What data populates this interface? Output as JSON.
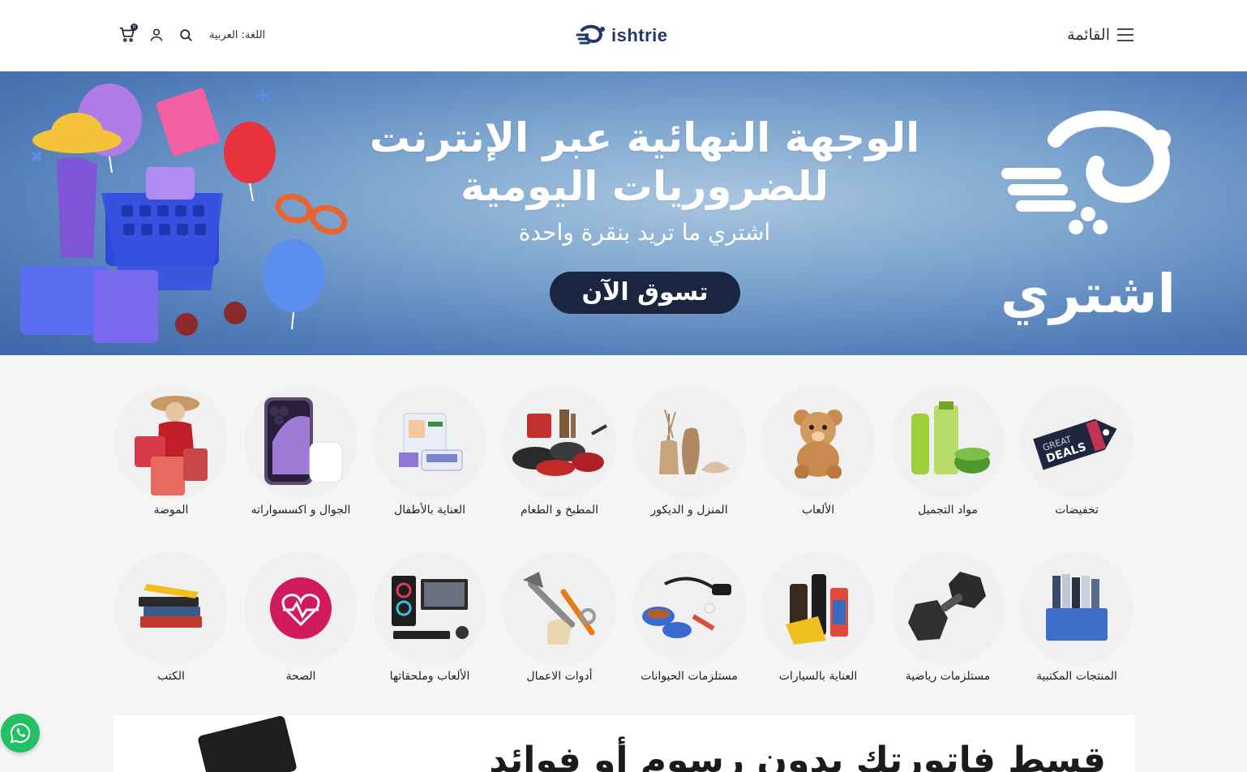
{
  "header": {
    "language_label": "اللغة: العربية",
    "cart_count": "0",
    "logo_text": "ishtrie",
    "menu_label": "القائمة"
  },
  "hero": {
    "title_line1": "الوجهة النهائية عبر الإنترنت",
    "title_line2": "للضروريات اليومية",
    "subtitle": "اشتري ما تريد بنقرة واحدة",
    "cta_label": "تسوق الآن",
    "brand_text": "اشتري"
  },
  "categories_row1": [
    {
      "label": "تخفيضات",
      "icon": "deals-tag-icon"
    },
    {
      "label": "مواد التجميل",
      "icon": "cosmetics-icon"
    },
    {
      "label": "الألعاب",
      "icon": "teddy-bear-icon"
    },
    {
      "label": "المنزل و الديكور",
      "icon": "vase-icon"
    },
    {
      "label": "المطبخ و الطعام",
      "icon": "cookware-icon"
    },
    {
      "label": "العناية بالأطفال",
      "icon": "baby-care-icon"
    },
    {
      "label": "الجوال و اكسسواراته",
      "icon": "phone-icon"
    },
    {
      "label": "الموضة",
      "icon": "fashion-icon"
    }
  ],
  "categories_row2": [
    {
      "label": "المنتجات المكتبية",
      "icon": "office-supplies-icon"
    },
    {
      "label": "مستلزمات رياضية",
      "icon": "dumbbell-icon"
    },
    {
      "label": "العناية بالسيارات",
      "icon": "car-care-icon"
    },
    {
      "label": "مستلزمات الحيوانات",
      "icon": "pet-supplies-icon"
    },
    {
      "label": "أدوات الاعمال",
      "icon": "tools-icon"
    },
    {
      "label": "الألعاب وملحقاتها",
      "icon": "gaming-pc-icon"
    },
    {
      "label": "الصحة",
      "icon": "health-heart-icon"
    },
    {
      "label": "الكتب",
      "icon": "books-icon"
    }
  ],
  "promo": {
    "text": "قسط فاتورتك بدون رسوم أو فوائد"
  },
  "colors": {
    "accent_dark": "#1c2540",
    "logo_blue": "#22386b",
    "hero_blue": "#4f7bb8",
    "whatsapp_green": "#21c063"
  }
}
